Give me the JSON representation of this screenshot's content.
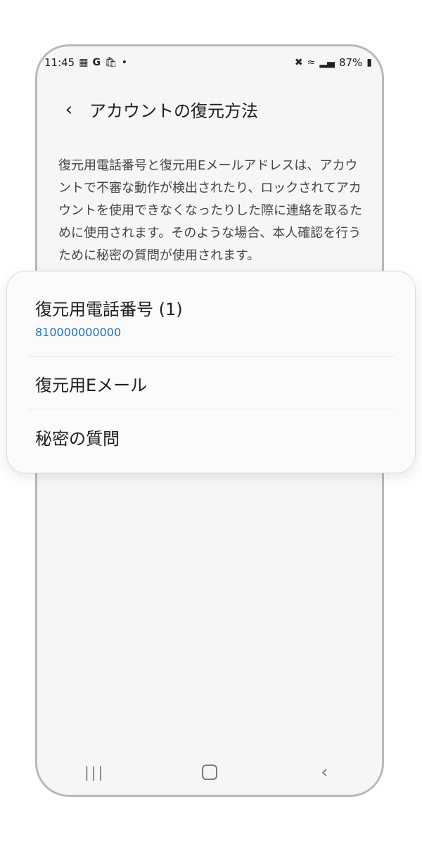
{
  "statusbar": {
    "time": "11:45",
    "left_icons": [
      "image-icon",
      "google-g-icon",
      "shopping-bag-icon",
      "dot-icon"
    ],
    "right_icons": [
      "mute-icon",
      "wifi-icon",
      "signal-icon",
      "battery-icon"
    ],
    "battery": "87%"
  },
  "header": {
    "title": "アカウントの復元方法"
  },
  "description": "復元用電話番号と復元用Eメールアドレスは、アカウントで不審な動作が検出されたり、ロックされてアカウントを使用できなくなったりした際に連絡を取るために使用されます。そのような場合、本人確認を行うために秘密の質問が使用されます。",
  "menu": {
    "items": [
      {
        "label": "復元用電話番号 (1)",
        "sub": "810000000000"
      },
      {
        "label": "復元用Eメール"
      },
      {
        "label": "秘密の質問"
      }
    ]
  },
  "navbar": {
    "recent": "recent-apps-icon",
    "home": "home-icon",
    "back": "back-icon"
  }
}
